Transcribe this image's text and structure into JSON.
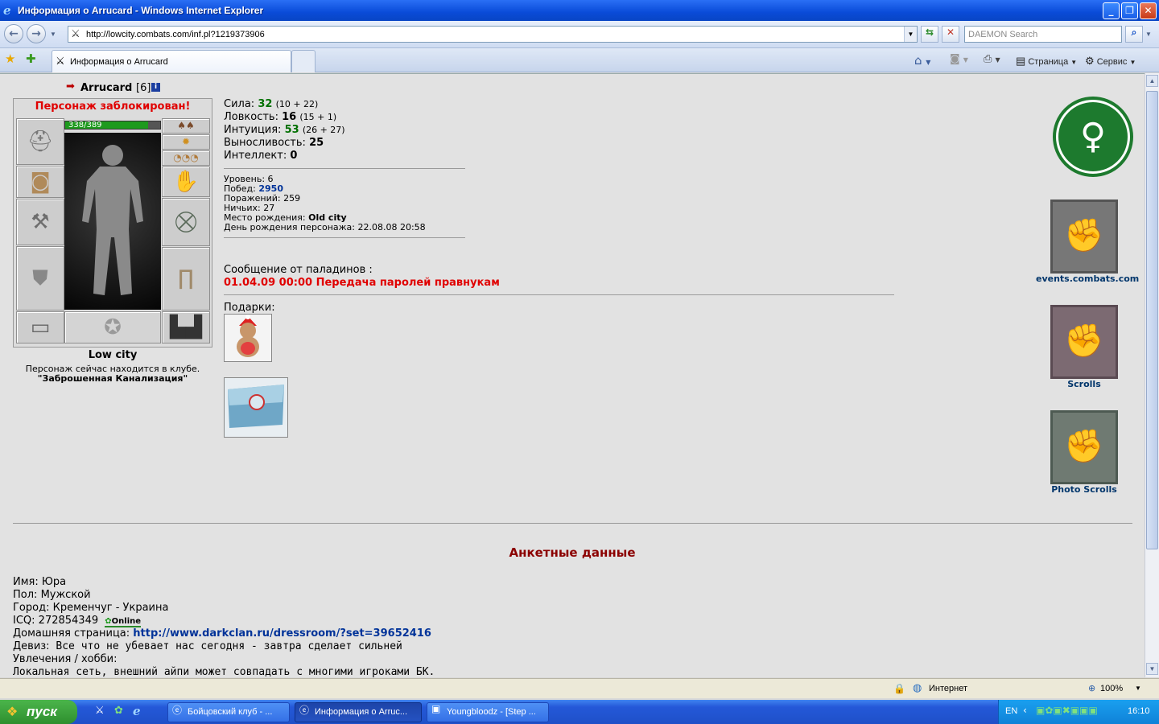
{
  "window": {
    "title": "Информация о Arrucard - Windows Internet Explorer",
    "minimize": "_",
    "maximize": "❐",
    "close": "✕"
  },
  "addressbar": {
    "url": "http://lowcity.combats.com/inf.pl?1219373906",
    "search_placeholder": "DAEMON Search"
  },
  "tabs": [
    {
      "label": "Информация о Arrucard"
    }
  ],
  "toolbar": {
    "page": "Страница",
    "service": "Сервис"
  },
  "character": {
    "name": "Arrucard",
    "level": "[6]",
    "blocked": "Персонаж заблокирован!",
    "hp": "338/389",
    "hp_fraction": 0.87,
    "city": "Low city",
    "location_line": "Персонаж сейчас находится в клубе.",
    "location": "\"Заброшенная Канализация\""
  },
  "stats": [
    {
      "label": "Сила:",
      "value": "32",
      "extra": "(10 + 22)"
    },
    {
      "label": "Ловкость:",
      "value": "16",
      "extra": "(15 + 1)"
    },
    {
      "label": "Интуиция:",
      "value": "53",
      "extra": "(26 + 27)"
    },
    {
      "label": "Выносливость:",
      "value": "25",
      "extra": ""
    },
    {
      "label": "Интеллект:",
      "value": "0",
      "extra": ""
    }
  ],
  "info": {
    "level_label": "Уровень:",
    "level": "6",
    "wins_label": "Побед:",
    "wins": "2950",
    "losses_label": "Поражений:",
    "losses": "259",
    "draws_label": "Ничьих:",
    "draws": "27",
    "birthplace_label": "Место рождения:",
    "birthplace": "Old city",
    "birthday_label": "День рождения персонажа:",
    "birthday": "22.08.08 20:58"
  },
  "paladin": {
    "title": "Сообщение от паладинов :",
    "message": "01.04.09 00:00 Передача паролей правнукам"
  },
  "gifts_label": "Подарки:",
  "side_links": [
    {
      "label": "events.combats.com"
    },
    {
      "label": "Scrolls"
    },
    {
      "label": "Photo Scrolls"
    }
  ],
  "profile": {
    "heading": "Анкетные данные",
    "name_label": "Имя:",
    "name": "Юра",
    "sex_label": "Пол:",
    "sex": "Мужской",
    "city_label": "Город:",
    "city": "Кременчуг - Украина",
    "icq_label": "ICQ:",
    "icq": "272854349",
    "icq_status": "Online",
    "homepage_label": "Домашняя страница:",
    "homepage": "http://www.darkclan.ru/dressroom/?set=39652416",
    "motto_label": "Девиз:",
    "motto": "Все что не убевает нас сегодня - завтра сделает сильней",
    "hobby_label": "Увлечения / хобби:",
    "hobby_text": "Локальная сеть, внешний айпи может совпадать с многими игроками БК."
  },
  "status": {
    "zone": "Интернет",
    "zoom": "100%"
  },
  "taskbar": {
    "start": "пуск",
    "tasks": [
      {
        "label": "Бойцовский клуб - ..."
      },
      {
        "label": "Информация о Arruc..."
      },
      {
        "label": "Youngbloodz - [Step ..."
      }
    ],
    "lang": "EN",
    "clock": "16:10"
  }
}
